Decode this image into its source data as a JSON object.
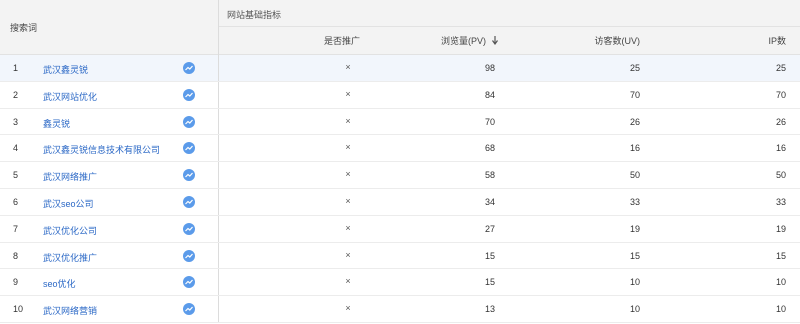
{
  "header": {
    "keyword_col": "搜索词",
    "group_title": "网站基础指标",
    "columns": {
      "promoted": "是否推广",
      "pv": "浏览量(PV)",
      "uv": "访客数(UV)",
      "ip": "IP数"
    },
    "sort_icon": "arrow-down-icon"
  },
  "rows": [
    {
      "idx": "1",
      "keyword": "武汉鑫灵锐",
      "promoted": "×",
      "pv": "98",
      "uv": "25",
      "ip": "25"
    },
    {
      "idx": "2",
      "keyword": "武汉网站优化",
      "promoted": "×",
      "pv": "84",
      "uv": "70",
      "ip": "70"
    },
    {
      "idx": "3",
      "keyword": "鑫灵锐",
      "promoted": "×",
      "pv": "70",
      "uv": "26",
      "ip": "26"
    },
    {
      "idx": "4",
      "keyword": "武汉鑫灵锐信息技术有限公司",
      "promoted": "×",
      "pv": "68",
      "uv": "16",
      "ip": "16"
    },
    {
      "idx": "5",
      "keyword": "武汉网络推广",
      "promoted": "×",
      "pv": "58",
      "uv": "50",
      "ip": "50"
    },
    {
      "idx": "6",
      "keyword": "武汉seo公司",
      "promoted": "×",
      "pv": "34",
      "uv": "33",
      "ip": "33"
    },
    {
      "idx": "7",
      "keyword": "武汉优化公司",
      "promoted": "×",
      "pv": "27",
      "uv": "19",
      "ip": "19"
    },
    {
      "idx": "8",
      "keyword": "武汉优化推广",
      "promoted": "×",
      "pv": "15",
      "uv": "15",
      "ip": "15"
    },
    {
      "idx": "9",
      "keyword": "seo优化",
      "promoted": "×",
      "pv": "15",
      "uv": "10",
      "ip": "10"
    },
    {
      "idx": "10",
      "keyword": "武汉网络营销",
      "promoted": "×",
      "pv": "13",
      "uv": "10",
      "ip": "10"
    }
  ],
  "colors": {
    "link": "#2b68c6",
    "trend_icon": "#5b9bea",
    "highlight_row": "#f2f6fc",
    "header_bg": "#f3f3f3"
  },
  "trend_icon": "trend-chart-icon"
}
